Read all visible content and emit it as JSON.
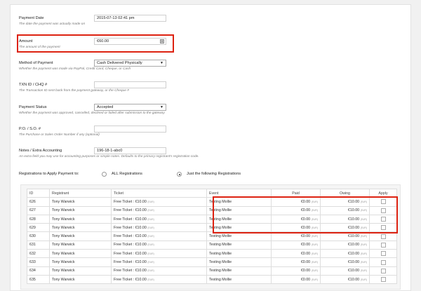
{
  "form": {
    "payment_date": {
      "label": "Payment Date",
      "value": "2015-07-13 02:41 pm",
      "desc": "The date the payment was actually made on"
    },
    "amount": {
      "label": "Amount",
      "value": "€60.00",
      "desc": "The amount of the payment"
    },
    "method": {
      "label": "Method of Payment",
      "value": "Cash Delivered Physically",
      "desc": "Whether the payment was made via PayPal, Credit Card, Cheque, or Cash"
    },
    "txn": {
      "label": "TXN ID / CHQ #",
      "value": "",
      "desc": "The Transaction ID sent back from the payment gateway, or the Cheque #"
    },
    "status": {
      "label": "Payment Status",
      "value": "Accepted",
      "desc": "Whether the payment was approved, cancelled, declined or failed after submission to the gateway"
    },
    "po": {
      "label": "P.O. / S.O. #",
      "value": "",
      "desc": "The Purchase or Sales Order Number if any (optional)"
    },
    "notes": {
      "label": "Notes / Extra Accounting",
      "value": "196-18-1-abc0",
      "desc": "An extra field you may use for accounting purposes or simple notes. Defaults to the primary registrant's registration code."
    }
  },
  "apply": {
    "label": "Registrations to Apply Payment to:",
    "option_all": "ALL Registrations",
    "option_some": "Just the following Registrations",
    "selected": "option_some"
  },
  "table": {
    "headers": {
      "id": "ID",
      "registrant": "Registrant",
      "ticket": "Ticket",
      "event": "Event",
      "paid": "Paid",
      "owing": "Owing",
      "apply": "Apply"
    },
    "currency_code": "(EUR)",
    "rows": [
      {
        "id": "626",
        "registrant": "Tony Warwick",
        "ticket": "Free Ticket : €10.00",
        "event": "Testing Mollie",
        "paid": "€0.00",
        "owing": "€10.00"
      },
      {
        "id": "627",
        "registrant": "Tony Warwick",
        "ticket": "Free Ticket : €10.00",
        "event": "Testing Mollie",
        "paid": "€0.00",
        "owing": "€10.00"
      },
      {
        "id": "628",
        "registrant": "Tony Warwick",
        "ticket": "Free Ticket : €10.00",
        "event": "Testing Mollie",
        "paid": "€0.00",
        "owing": "€10.00"
      },
      {
        "id": "629",
        "registrant": "Tony Warwick",
        "ticket": "Free Ticket : €10.00",
        "event": "Testing Mollie",
        "paid": "€0.00",
        "owing": "€10.00"
      },
      {
        "id": "630",
        "registrant": "Tony Warwick",
        "ticket": "Free Ticket : €10.00",
        "event": "Testing Mollie",
        "paid": "€0.00",
        "owing": "€10.00"
      },
      {
        "id": "631",
        "registrant": "Tony Warwick",
        "ticket": "Free Ticket : €10.00",
        "event": "Testing Mollie",
        "paid": "€0.00",
        "owing": "€10.00"
      },
      {
        "id": "632",
        "registrant": "Tony Warwick",
        "ticket": "Free Ticket : €10.00",
        "event": "Testing Mollie",
        "paid": "€0.00",
        "owing": "€10.00"
      },
      {
        "id": "633",
        "registrant": "Tony Warwick",
        "ticket": "Free Ticket : €10.00",
        "event": "Testing Mollie",
        "paid": "€0.00",
        "owing": "€10.00"
      },
      {
        "id": "634",
        "registrant": "Tony Warwick",
        "ticket": "Free Ticket : €10.00",
        "event": "Testing Mollie",
        "paid": "€0.00",
        "owing": "€10.00"
      },
      {
        "id": "635",
        "registrant": "Tony Warwick",
        "ticket": "Free Ticket : €10.00",
        "event": "Testing Mollie",
        "paid": "€0.00",
        "owing": "€10.00"
      }
    ]
  },
  "icons": {
    "calculator": "calculator-icon",
    "dropdown": "chevron-down-icon"
  },
  "colors": {
    "highlight": "#dd1111",
    "panel": "#ffffff",
    "background": "#f1f1f1"
  }
}
